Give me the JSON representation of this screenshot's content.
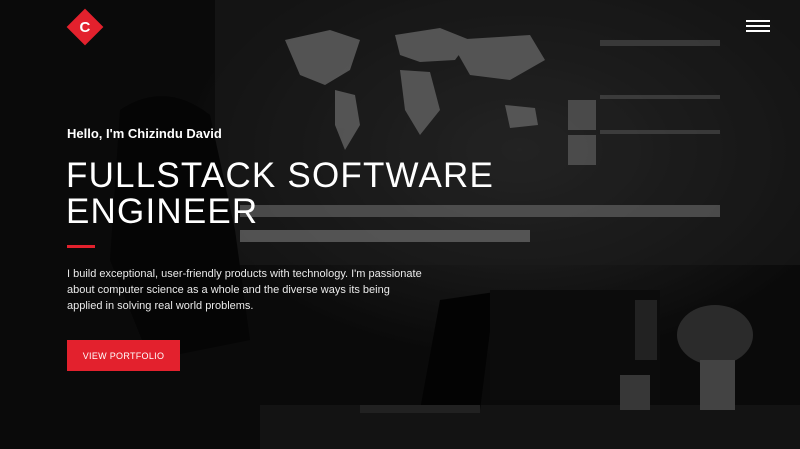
{
  "header": {
    "logo_letter": "C",
    "menu_icon": "hamburger-menu-icon"
  },
  "hero": {
    "greeting": "Hello, I'm Chizindu David",
    "title": "FULLSTACK SOFTWARE ENGINEER",
    "description": "I build exceptional, user-friendly products with technology. I'm passionate about computer science as a whole and the diverse ways its being applied in solving real world problems.",
    "cta_label": "VIEW PORTFOLIO"
  },
  "colors": {
    "accent": "#e3212d",
    "text": "#ffffff",
    "background": "#0c0c0c"
  }
}
